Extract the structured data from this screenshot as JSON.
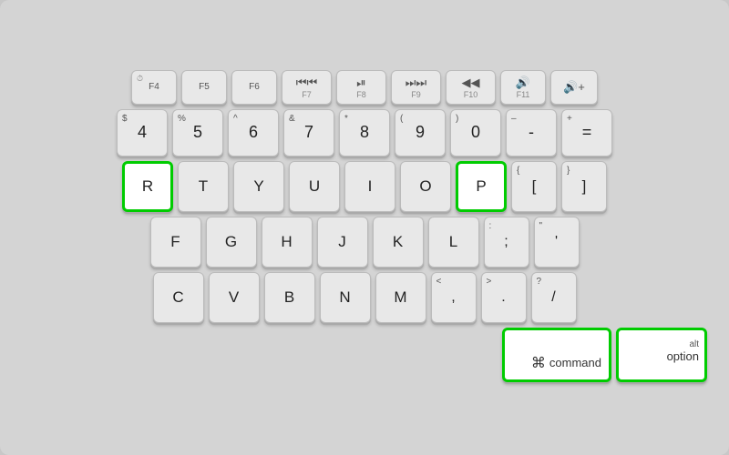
{
  "keyboard": {
    "background": "#d4d4d4",
    "rows": {
      "fn": [
        "F4",
        "F5",
        "F6",
        "⏮",
        "F7",
        "⏯",
        "⏭",
        "F9",
        "◀",
        "F10",
        "🔊",
        "F11"
      ],
      "num": [
        "$\n4",
        "%\n5",
        "^\n6",
        "&\n7",
        "*\n8",
        "(\n9",
        ")\n0",
        "-\n—",
        "+\n="
      ],
      "top": [
        "R",
        "T",
        "Y",
        "U",
        "I",
        "O",
        "P",
        "{\n[",
        "}\n]"
      ],
      "mid": [
        "F",
        "G",
        "H",
        "J",
        "K",
        "L",
        ":\n;",
        "\"\n'"
      ],
      "bot": [
        "C",
        "V",
        "B",
        "N",
        "M",
        "<\n,",
        ">\n.",
        "?\n/"
      ],
      "space": [
        "command",
        "option"
      ]
    },
    "highlighted_keys": [
      "R",
      "P",
      "command",
      "option"
    ]
  }
}
